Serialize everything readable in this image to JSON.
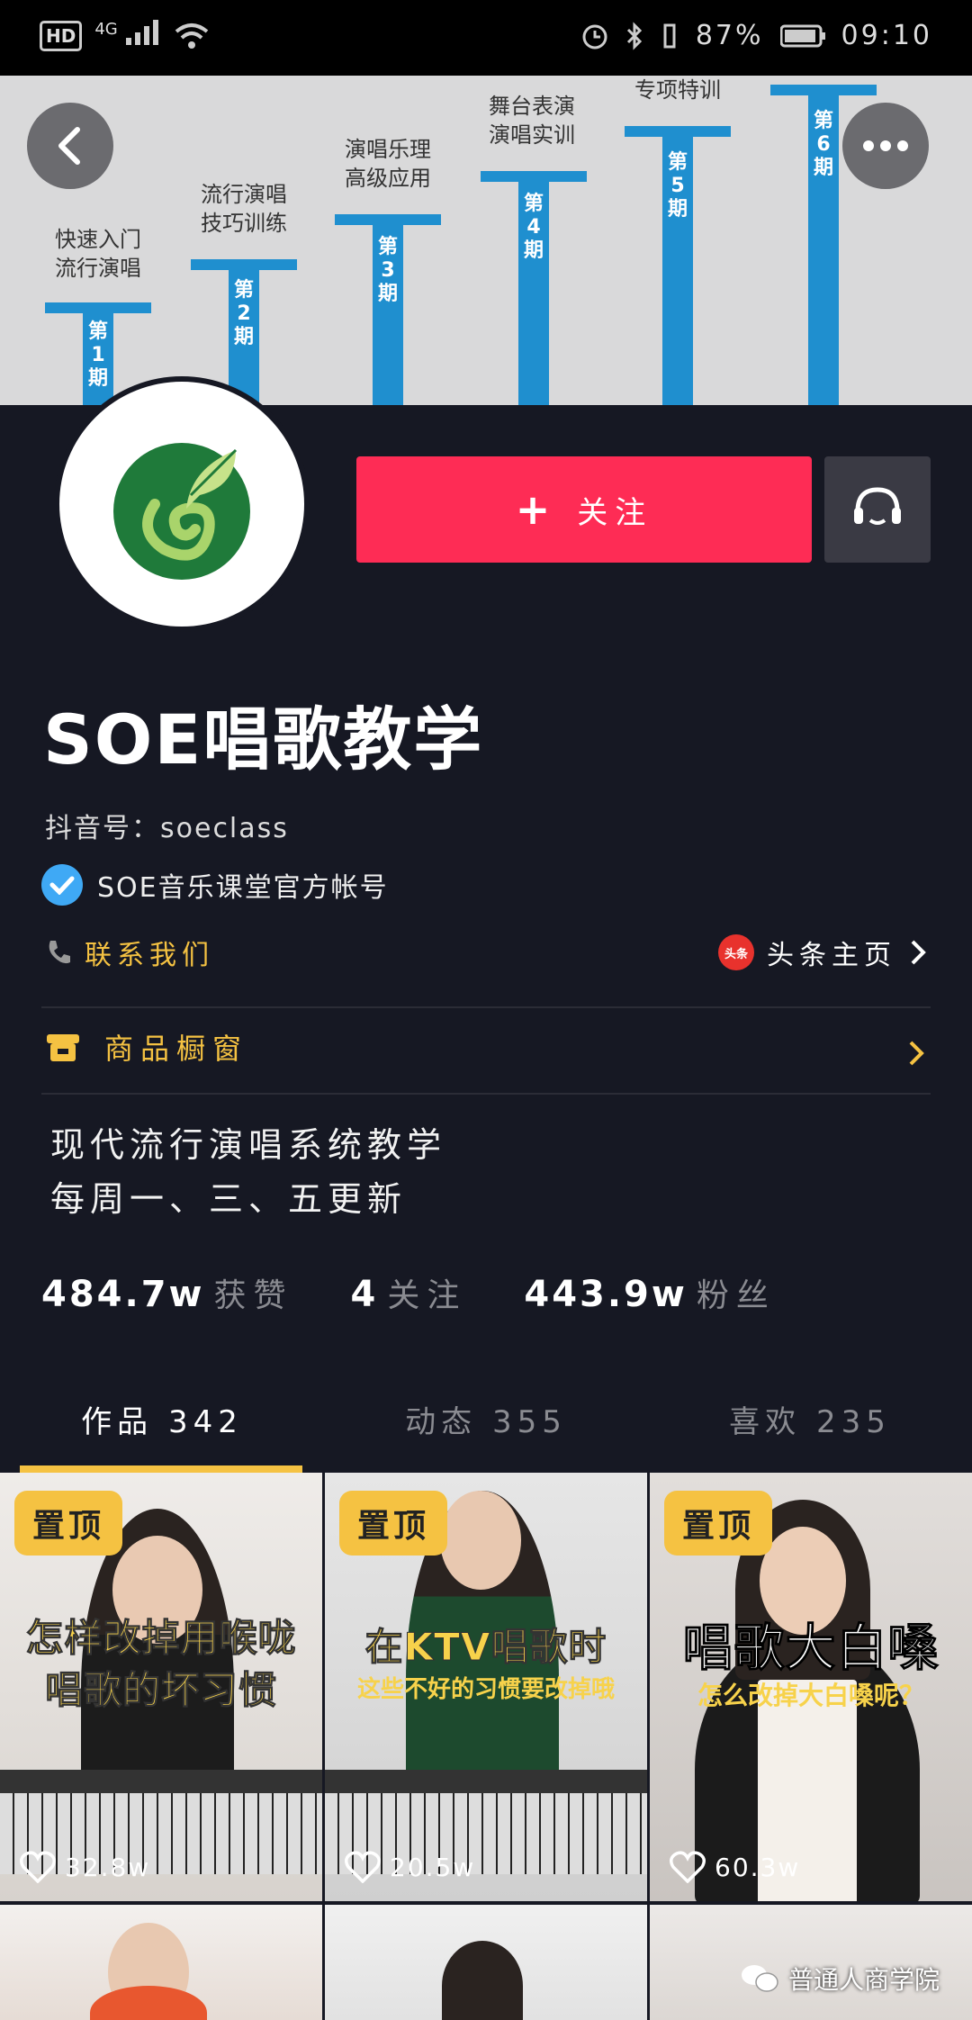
{
  "status_bar": {
    "hd": "HD",
    "network": "4G",
    "battery": "87%",
    "time": "09:10"
  },
  "banner": {
    "steps": [
      {
        "label1": "快速入门",
        "label2": "流行演唱",
        "period": "第1期"
      },
      {
        "label1": "流行演唱",
        "label2": "技巧训练",
        "period": "第2期"
      },
      {
        "label1": "演唱乐理",
        "label2": "高级应用",
        "period": "第3期"
      },
      {
        "label1": "舞台表演",
        "label2": "演唱实训",
        "period": "第4期"
      },
      {
        "label1": "专项特训",
        "label2": "",
        "period": "第5期"
      },
      {
        "label1": "",
        "label2": "",
        "period": "第6期"
      }
    ]
  },
  "profile": {
    "follow_label": "关注",
    "name": "SOE唱歌教学",
    "douyin_id": "抖音号：soeclass",
    "verified_text": "SOE音乐课堂官方帐号",
    "contact_label": "联系我们",
    "toutiao_badge": "头条",
    "toutiao_label": "头条主页",
    "shop_label": "商品橱窗",
    "bio_line1": "现代流行演唱系统教学",
    "bio_line2": "每周一、三、五更新",
    "stats": {
      "likes_num": "484.7w",
      "likes_label": "获赞",
      "following_num": "4",
      "following_label": "关注",
      "fans_num": "443.9w",
      "fans_label": "粉丝"
    }
  },
  "tabs": [
    {
      "label": "作品 342"
    },
    {
      "label": "动态 355"
    },
    {
      "label": "喜欢 235"
    }
  ],
  "videos": [
    {
      "pin": "置顶",
      "title": "怎样改掉用喉咙",
      "title2": "唱歌的坏习惯",
      "subtitle": "",
      "likes": "32.8w"
    },
    {
      "pin": "置顶",
      "title": "在KTV唱歌时",
      "title2": "",
      "subtitle": "这些不好的习惯要改掉哦",
      "likes": "20.5w"
    },
    {
      "pin": "置顶",
      "title": "唱歌大白嗓",
      "title2": "",
      "subtitle": "怎么改掉大白嗓呢？",
      "likes": "60.3w"
    }
  ],
  "watermark": "普通人商学院",
  "colors": {
    "background": "#161823",
    "follow": "#fe2c55",
    "accent": "#f5c242",
    "verified": "#3fa9f5",
    "banner_blue": "#1f8fcf"
  }
}
